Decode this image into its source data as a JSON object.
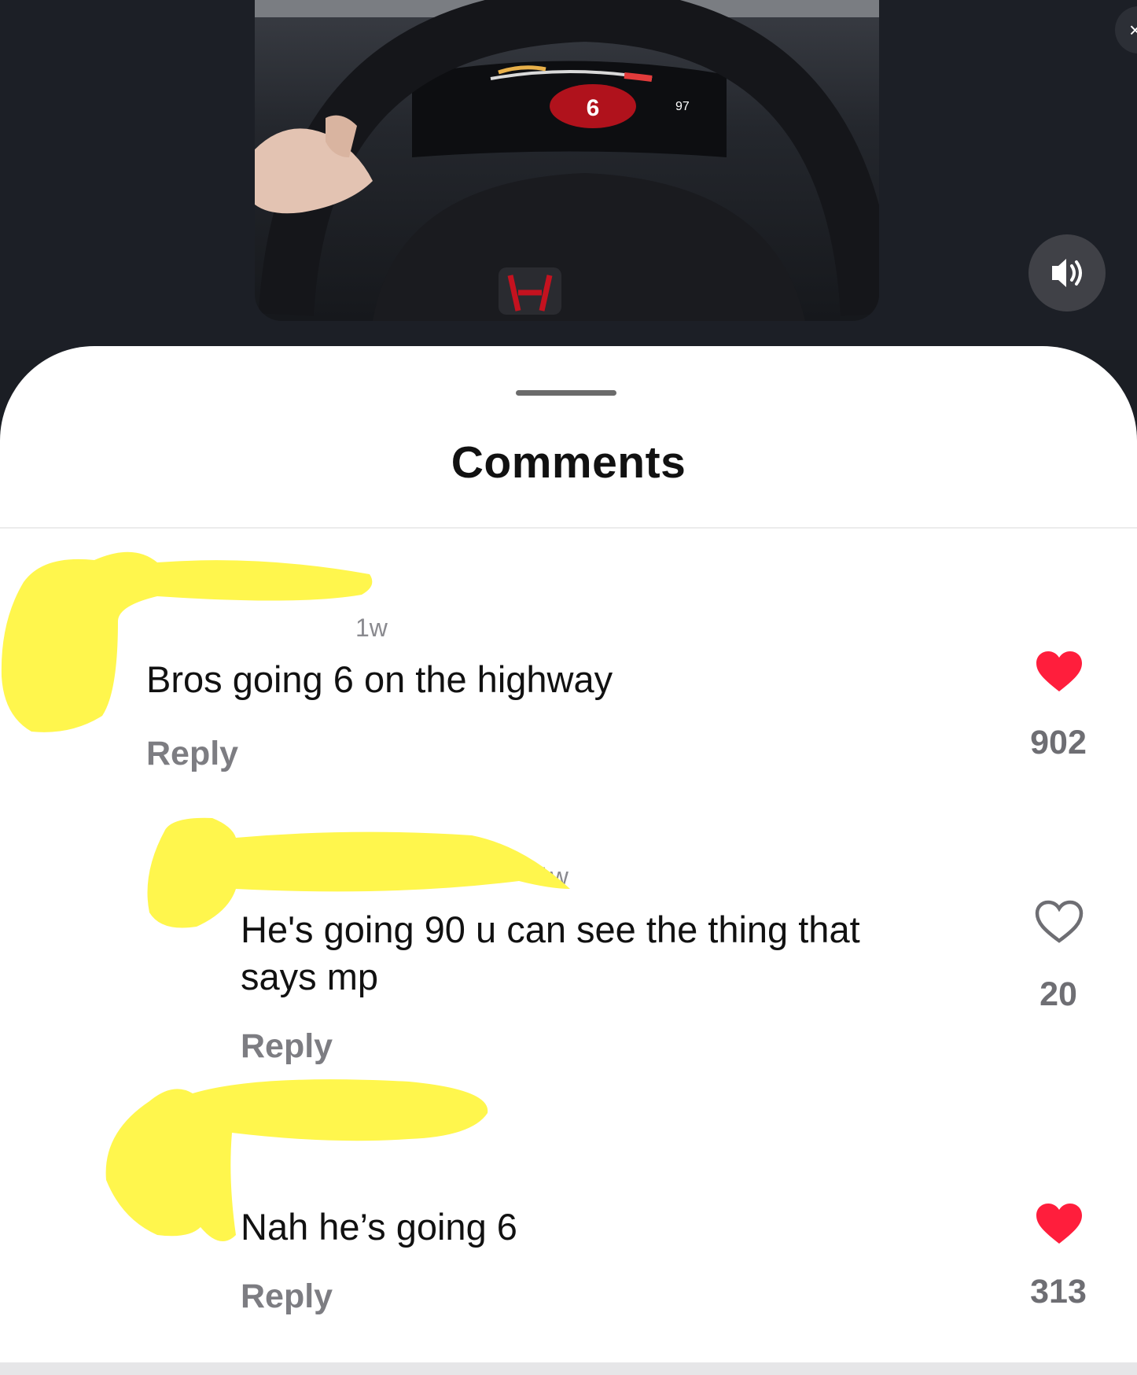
{
  "video": {
    "close_glyph": "×",
    "volume_icon": "volume-on-icon",
    "dashboard_gear": "6",
    "dashboard_speed": "97"
  },
  "comments_panel": {
    "title": "Comments",
    "comments": [
      {
        "timestamp": "1w",
        "text": "Bros going 6 on the highway",
        "reply_label": "Reply",
        "likes": "902",
        "liked": true
      },
      {
        "timestamp": "1w",
        "text": "He's going 90 u can see the thing that",
        "text_line2": "says mp",
        "reply_label": "Reply",
        "likes": "20",
        "liked": false
      },
      {
        "text": "Nah he’s going 6",
        "reply_label": "Reply",
        "likes": "313",
        "liked": true
      }
    ]
  },
  "colors": {
    "like_red": "#ff1e3c",
    "redaction_yellow": "#fff64d",
    "sheet_bg": "#ffffff",
    "backdrop": "#1c1f26"
  }
}
